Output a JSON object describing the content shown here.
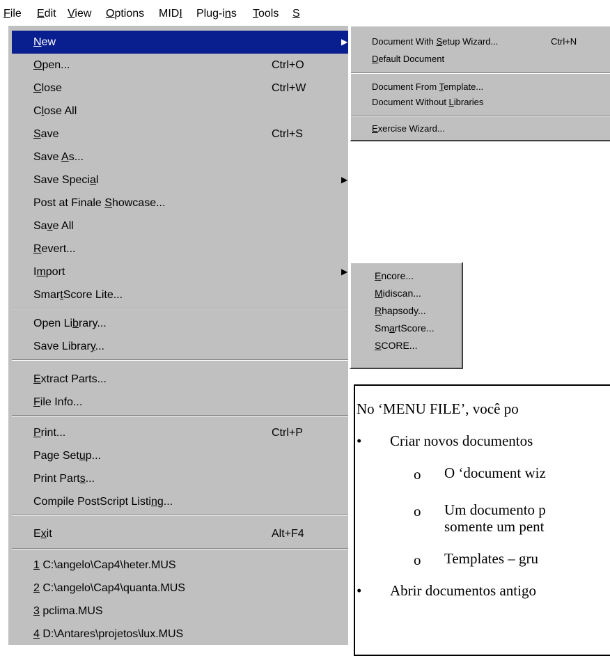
{
  "menubar": {
    "items": [
      {
        "label": "File",
        "ul": 0
      },
      {
        "label": "Edit",
        "ul": 0
      },
      {
        "label": "View",
        "ul": 0
      },
      {
        "label": "Options",
        "ul": 0
      },
      {
        "label": "MIDI",
        "ul": 3
      },
      {
        "label": "Plug-ins",
        "ul": 6
      },
      {
        "label": "Tools",
        "ul": 0
      },
      {
        "label": "S",
        "ul": 0
      }
    ]
  },
  "file_menu": {
    "items": [
      {
        "label": "New",
        "ul": 0,
        "submenu": true,
        "selected": true
      },
      {
        "label": "Open...",
        "ul": 0,
        "shortcut": "Ctrl+O"
      },
      {
        "label": "Close",
        "ul": 0,
        "shortcut": "Ctrl+W"
      },
      {
        "label": "Close All",
        "ul": 1
      },
      {
        "label": "Save",
        "ul": 0,
        "shortcut": "Ctrl+S"
      },
      {
        "label": "Save As...",
        "ul": 5
      },
      {
        "label": "Save Special",
        "ul": 10,
        "submenu": true
      },
      {
        "label": "Post at Finale Showcase...",
        "ul": 15
      },
      {
        "label": "Save All",
        "ul": 2
      },
      {
        "label": "Revert...",
        "ul": 0
      },
      {
        "label": "Import",
        "ul": 1,
        "submenu": true
      },
      {
        "label": "SmartScore Lite...",
        "ul": 4
      },
      {
        "label": "Open Library...",
        "ul": 7
      },
      {
        "label": "Save Library...",
        "ul": 11
      },
      {
        "label": "Extract Parts...",
        "ul": 0
      },
      {
        "label": "File Info...",
        "ul": 0
      },
      {
        "label": "Print...",
        "ul": 0,
        "shortcut": "Ctrl+P"
      },
      {
        "label": "Page Setup...",
        "ul": 8
      },
      {
        "label": "Print Parts...",
        "ul": 10
      },
      {
        "label": "Compile PostScript Listing...",
        "ul": 24
      },
      {
        "label": "Exit",
        "ul": 1,
        "shortcut": "Alt+F4"
      },
      {
        "label": "1 C:\\angelo\\Cap4\\heter.MUS",
        "ul": 0
      },
      {
        "label": "2 C:\\angelo\\Cap4\\quanta.MUS",
        "ul": 0
      },
      {
        "label": "3 pclima.MUS",
        "ul": 0
      },
      {
        "label": "4 D:\\Antares\\projetos\\lux.MUS",
        "ul": 0
      }
    ]
  },
  "new_submenu": {
    "items": [
      {
        "label": "Document With Setup Wizard...",
        "ul": 14,
        "shortcut": "Ctrl+N"
      },
      {
        "label": "Default Document",
        "ul": 0
      },
      {
        "label": "Document From Template...",
        "ul": 14
      },
      {
        "label": "Document Without Libraries",
        "ul": 17
      },
      {
        "label": "Exercise Wizard...",
        "ul": 0
      }
    ]
  },
  "import_submenu": {
    "items": [
      {
        "label": "Encore...",
        "ul": 0
      },
      {
        "label": "Midiscan...",
        "ul": 0
      },
      {
        "label": "Rhapsody...",
        "ul": 0
      },
      {
        "label": "SmartScore...",
        "ul": 2
      },
      {
        "label": "SCORE...",
        "ul": 0
      }
    ]
  },
  "textbox": {
    "line1": "No ‘MENU FILE’, você po",
    "bullet1": "Criar novos documentos",
    "sub1": "O ‘document wiz",
    "sub2a": "Um documento p",
    "sub2b": "somente um pent",
    "sub3": "Templates – gru",
    "bullet2": "Abrir documentos antigo",
    "bullet_char": "•",
    "sub_bullet_char": "o"
  }
}
